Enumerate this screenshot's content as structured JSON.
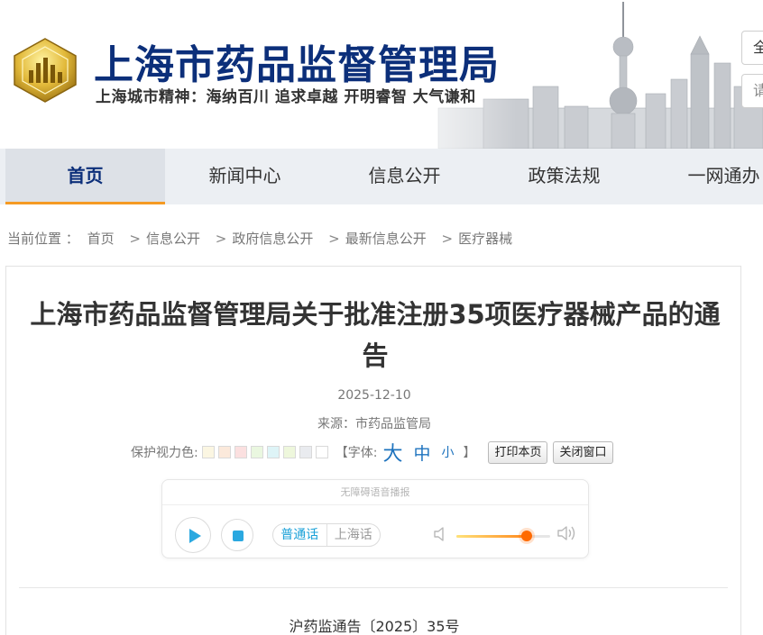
{
  "header": {
    "site_title": "上海市药品监督管理局",
    "slogan": "上海城市精神：海纳百川  追求卓越  开明睿智  大气谦和",
    "btn_top": "全",
    "btn_bottom": "请"
  },
  "nav": {
    "items": [
      {
        "label": "首页",
        "active": true
      },
      {
        "label": "新闻中心",
        "active": false
      },
      {
        "label": "信息公开",
        "active": false
      },
      {
        "label": "政策法规",
        "active": false
      },
      {
        "label": "一网通办",
        "active": false
      }
    ]
  },
  "breadcrumb": {
    "prefix": "当前位置 ：",
    "items": [
      "首页",
      "信息公开",
      "政府信息公开",
      "最新信息公开",
      "医疗器械"
    ],
    "sep": ">"
  },
  "article": {
    "title": "上海市药品监督管理局关于批准注册35项医疗器械产品的通告",
    "date": "2025-12-10",
    "source": "来源：市药品监管局",
    "doc_number": "沪药监通告〔2025〕35号"
  },
  "tools": {
    "eye_label": "保护视力色:",
    "swatches": [
      "#fbf6e2",
      "#fbe9db",
      "#fbe0e0",
      "#eaf7e0",
      "#def4f7",
      "#eef7dc",
      "#e9ebef",
      "#ffffff"
    ],
    "font_label": "【字体:",
    "font_large": "大",
    "font_medium": "中",
    "font_small": "小",
    "font_close": "】",
    "print_label": "打印本页",
    "close_label": "关闭窗口"
  },
  "player": {
    "header": "无障碍语音播报",
    "lang_1": "普通话",
    "lang_2": "上海话",
    "active_lang": "普通话",
    "volume": 0.75,
    "accent": "#1aa1d8"
  }
}
